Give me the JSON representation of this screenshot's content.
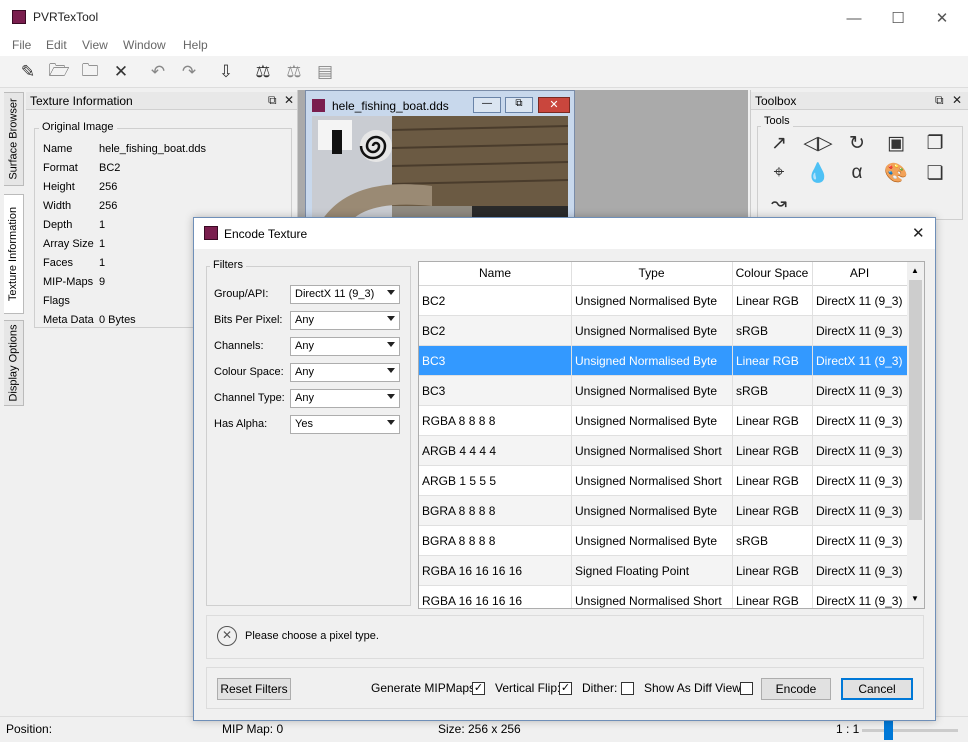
{
  "app": {
    "title": "PVRTexTool"
  },
  "menu": [
    "File",
    "Edit",
    "View",
    "Window",
    "Help"
  ],
  "side_tabs": [
    "Surface Browser",
    "Texture Information",
    "Display Options"
  ],
  "texture_info": {
    "panel_title": "Texture Information",
    "group_title": "Original Image",
    "rows": [
      {
        "k": "Name",
        "v": "hele_fishing_boat.dds"
      },
      {
        "k": "Format",
        "v": "BC2"
      },
      {
        "k": "Height",
        "v": "256"
      },
      {
        "k": "Width",
        "v": "256"
      },
      {
        "k": "Depth",
        "v": "1"
      },
      {
        "k": "Array Size",
        "v": "1"
      },
      {
        "k": "Faces",
        "v": "1"
      },
      {
        "k": "MIP-Maps",
        "v": "9"
      },
      {
        "k": "Flags",
        "v": ""
      },
      {
        "k": "Meta Data",
        "v": "0 Bytes"
      }
    ]
  },
  "doc_window": {
    "title": "hele_fishing_boat.dds"
  },
  "toolbox": {
    "title": "Toolbox",
    "group_title": "Tools"
  },
  "status": {
    "position": "Position:",
    "mip_map": "MIP Map: 0",
    "size": "Size: 256 x 256",
    "zoom": "1 : 1"
  },
  "dialog": {
    "title": "Encode Texture",
    "filters_title": "Filters",
    "filters": [
      {
        "label": "Group/API:",
        "value": "DirectX 11 (9_3)"
      },
      {
        "label": "Bits Per Pixel:",
        "value": "Any"
      },
      {
        "label": "Channels:",
        "value": "Any"
      },
      {
        "label": "Colour Space:",
        "value": "Any"
      },
      {
        "label": "Channel Type:",
        "value": "Any"
      },
      {
        "label": "Has Alpha:",
        "value": "Yes"
      }
    ],
    "columns": [
      "Name",
      "Type",
      "Colour Space",
      "API"
    ],
    "rows": [
      {
        "name": "BC2",
        "type": "Unsigned Normalised Byte",
        "space": "Linear RGB",
        "api": "DirectX 11 (9_3)"
      },
      {
        "name": "BC2",
        "type": "Unsigned Normalised Byte",
        "space": "sRGB",
        "api": "DirectX 11 (9_3)"
      },
      {
        "name": "BC3",
        "type": "Unsigned Normalised Byte",
        "space": "Linear RGB",
        "api": "DirectX 11 (9_3)"
      },
      {
        "name": "BC3",
        "type": "Unsigned Normalised Byte",
        "space": "sRGB",
        "api": "DirectX 11 (9_3)"
      },
      {
        "name": "RGBA 8 8 8 8",
        "type": "Unsigned Normalised Byte",
        "space": "Linear RGB",
        "api": "DirectX 11 (9_3)"
      },
      {
        "name": "ARGB 4 4 4 4",
        "type": "Unsigned Normalised Short",
        "space": "Linear RGB",
        "api": "DirectX 11 (9_3)"
      },
      {
        "name": "ARGB 1 5 5 5",
        "type": "Unsigned Normalised Short",
        "space": "Linear RGB",
        "api": "DirectX 11 (9_3)"
      },
      {
        "name": "BGRA 8 8 8 8",
        "type": "Unsigned Normalised Byte",
        "space": "Linear RGB",
        "api": "DirectX 11 (9_3)"
      },
      {
        "name": "BGRA 8 8 8 8",
        "type": "Unsigned Normalised Byte",
        "space": "sRGB",
        "api": "DirectX 11 (9_3)"
      },
      {
        "name": "RGBA 16 16 16 16",
        "type": "Signed Floating Point",
        "space": "Linear RGB",
        "api": "DirectX 11 (9_3)"
      },
      {
        "name": "RGBA 16 16 16 16",
        "type": "Unsigned Normalised Short",
        "space": "Linear RGB",
        "api": "DirectX 11 (9_3)"
      }
    ],
    "selected_row": 2,
    "message": "Please choose a pixel type.",
    "reset_label": "Reset Filters",
    "options": [
      {
        "label": "Generate MIPMaps:",
        "checked": true
      },
      {
        "label": "Vertical Flip:",
        "checked": true
      },
      {
        "label": "Dither:",
        "checked": false
      },
      {
        "label": "Show As Diff View:",
        "checked": false
      }
    ],
    "encode_label": "Encode",
    "cancel_label": "Cancel"
  },
  "colors": {
    "selection": "#3399ff",
    "accent_border": "#0078d7"
  }
}
